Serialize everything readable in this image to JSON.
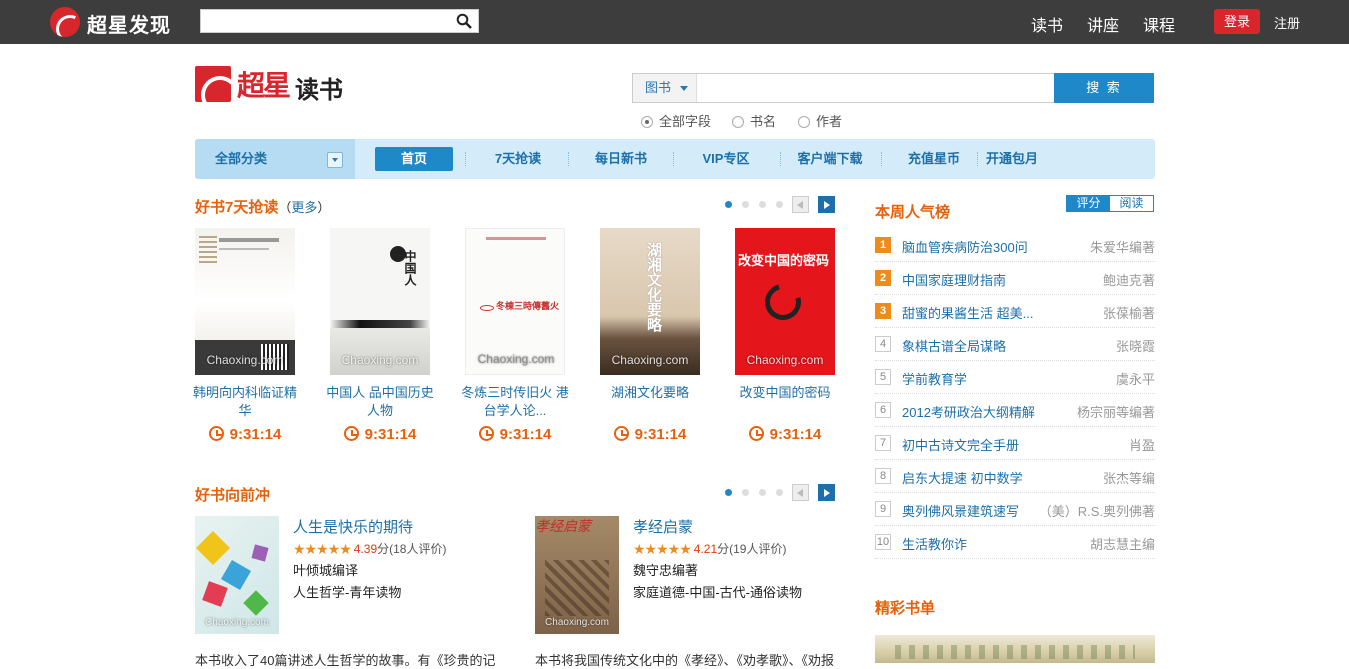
{
  "topbar": {
    "logo_text": "超星发现",
    "search_placeholder": "",
    "nav": [
      "读书",
      "讲座",
      "课程"
    ],
    "login": "登录",
    "register": "注册"
  },
  "brand": {
    "logo_cn": "超星",
    "section": "读书"
  },
  "search": {
    "type": "图书",
    "placeholder": "",
    "button": "搜 索",
    "options": [
      "全部字段",
      "书名",
      "作者"
    ],
    "selected": "全部字段"
  },
  "navbar": {
    "all": "全部分类",
    "items": [
      "首页",
      "7天抢读",
      "每日新书",
      "VIP专区",
      "客户端下载",
      "充值星币",
      "开通包月"
    ],
    "active": "首页"
  },
  "section1": {
    "title": "好书7天抢读",
    "more_prefix": "（",
    "more": "更多",
    "more_suffix": "）",
    "books": [
      {
        "title": "韩明向内科临证精华",
        "timer": "9:31:14",
        "watermark": "Chaoxing.com"
      },
      {
        "title": "中国人 品中国历史人物",
        "timer": "9:31:14",
        "watermark": "Chaoxing.com",
        "cover_text": "中国人"
      },
      {
        "title": "冬炼三时传旧火 港台学人论...",
        "timer": "9:31:14",
        "watermark": "Chaoxing.com",
        "cover_text": "冬棟三時傳舊火"
      },
      {
        "title": "湖湘文化要略",
        "timer": "9:31:14",
        "watermark": "Chaoxing.com",
        "cover_text": "湖湘文化要略"
      },
      {
        "title": "改变中国的密码",
        "timer": "9:31:14",
        "watermark": "Chaoxing.com",
        "cover_text": "改变中国的密码"
      }
    ]
  },
  "section2": {
    "title": "好书向前冲",
    "books": [
      {
        "title": "人生是快乐的期待",
        "score": "4.39",
        "score_unit": "分",
        "reviews": "(18人评价)",
        "author": "叶倾城编译",
        "category": "人生哲学-青年读物",
        "desc": "本书收入了40篇讲述人生哲学的故事。有《珍贵的记",
        "watermark": "Chaoxing.com",
        "stars": "★★★★★"
      },
      {
        "title": "孝经启蒙",
        "score": "4.21",
        "score_unit": "分",
        "reviews": "(19人评价)",
        "author": "魏守忠编著",
        "category": "家庭道德-中国-古代-通俗读物",
        "desc": "本书将我国传统文化中的《孝经》、《劝孝歌》、《劝报",
        "watermark": "Chaoxing.com",
        "stars": "★★★★★",
        "cover_text": "孝经启蒙"
      }
    ]
  },
  "ranking": {
    "title": "本周人气榜",
    "tabs": [
      "评分",
      "阅读"
    ],
    "items": [
      {
        "num": "1",
        "name": "脑血管疾病防治300问",
        "author": "朱爱华编著"
      },
      {
        "num": "2",
        "name": "中国家庭理财指南",
        "author": "鲍迪克著"
      },
      {
        "num": "3",
        "name": "甜蜜的果酱生活 超美...",
        "author": "张葆榆著"
      },
      {
        "num": "4",
        "name": "象棋古谱全局谋略",
        "author": "张晓霞"
      },
      {
        "num": "5",
        "name": "学前教育学",
        "author": "虞永平"
      },
      {
        "num": "6",
        "name": "2012考研政治大纲精解",
        "author": "杨宗丽等编著"
      },
      {
        "num": "7",
        "name": "初中古诗文完全手册",
        "author": "肖盈"
      },
      {
        "num": "8",
        "name": "启东大提速 初中数学",
        "author": "张杰等编"
      },
      {
        "num": "9",
        "name": "奥列佛风景建筑速写",
        "author": "（美）R.S.奥列佛著"
      },
      {
        "num": "10",
        "name": "生活教你诈",
        "author": "胡志慧主编"
      }
    ]
  },
  "jingcai": {
    "title": "精彩书单"
  },
  "colors": {
    "accent": "#e8600c",
    "link": "#1e6fa8",
    "brand_red": "#d8262d",
    "button_blue": "#1e88c9"
  }
}
